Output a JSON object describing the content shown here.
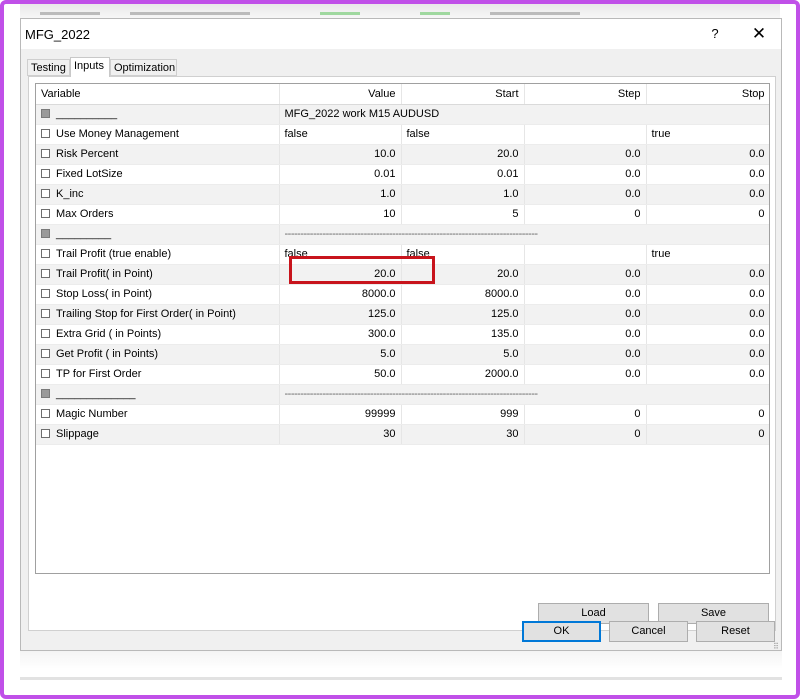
{
  "dialog": {
    "title": "MFG_2022",
    "help_label": "?",
    "close_label": "✕"
  },
  "tabs": [
    {
      "label": "Testing"
    },
    {
      "label": "Inputs"
    },
    {
      "label": "Optimization"
    }
  ],
  "grid": {
    "columns": [
      "Variable",
      "Value",
      "Start",
      "Step",
      "Stop"
    ],
    "rows": [
      {
        "type": "sep",
        "name": "__________",
        "value": "MFG_2022 work M15 AUDUSD"
      },
      {
        "type": "param",
        "name": "Use Money Management",
        "value": "false",
        "start": "false",
        "step": "",
        "stop": "true",
        "text": true
      },
      {
        "type": "param",
        "name": "Risk Percent",
        "value": "10.0",
        "start": "20.0",
        "step": "0.0",
        "stop": "0.0"
      },
      {
        "type": "param",
        "name": "Fixed LotSize",
        "value": "0.01",
        "start": "0.01",
        "step": "0.0",
        "stop": "0.0"
      },
      {
        "type": "param",
        "name": "K_inc",
        "value": "1.0",
        "start": "1.0",
        "step": "0.0",
        "stop": "0.0"
      },
      {
        "type": "param",
        "name": "Max Orders",
        "value": "10",
        "start": "5",
        "step": "0",
        "stop": "0"
      },
      {
        "type": "sep",
        "name": "_________",
        "value": "--------------------------------------------------------------------------------"
      },
      {
        "type": "param",
        "name": "Trail Profit (true enable)",
        "value": "false",
        "start": "false",
        "step": "",
        "stop": "true",
        "text": true
      },
      {
        "type": "param",
        "name": "Trail Profit( in Point)",
        "value": "20.0",
        "start": "20.0",
        "step": "0.0",
        "stop": "0.0"
      },
      {
        "type": "param",
        "name": "Stop Loss( in Point)",
        "value": "8000.0",
        "start": "8000.0",
        "step": "0.0",
        "stop": "0.0"
      },
      {
        "type": "param",
        "name": "Trailing Stop for First Order( in Point)",
        "value": "125.0",
        "start": "125.0",
        "step": "0.0",
        "stop": "0.0"
      },
      {
        "type": "param",
        "name": "Extra Grid ( in Points)",
        "value": "300.0",
        "start": "135.0",
        "step": "0.0",
        "stop": "0.0"
      },
      {
        "type": "param",
        "name": "Get Profit ( in Points)",
        "value": "5.0",
        "start": "5.0",
        "step": "0.0",
        "stop": "0.0"
      },
      {
        "type": "param",
        "name": "TP for First Order",
        "value": "50.0",
        "start": "2000.0",
        "step": "0.0",
        "stop": "0.0"
      },
      {
        "type": "sep",
        "name": "_____________",
        "value": "--------------------------------------------------------------------------------"
      },
      {
        "type": "param",
        "name": "Magic Number",
        "value": "99999",
        "start": "999",
        "step": "0",
        "stop": "0"
      },
      {
        "type": "param",
        "name": "Slippage",
        "value": "30",
        "start": "30",
        "step": "0",
        "stop": "0"
      }
    ]
  },
  "buttons": {
    "load": "Load",
    "save": "Save",
    "ok": "OK",
    "cancel": "Cancel",
    "reset": "Reset"
  },
  "colors": {
    "highlight": "#c8141c",
    "frame": "#c050e8",
    "default_button_border": "#0078d7"
  }
}
